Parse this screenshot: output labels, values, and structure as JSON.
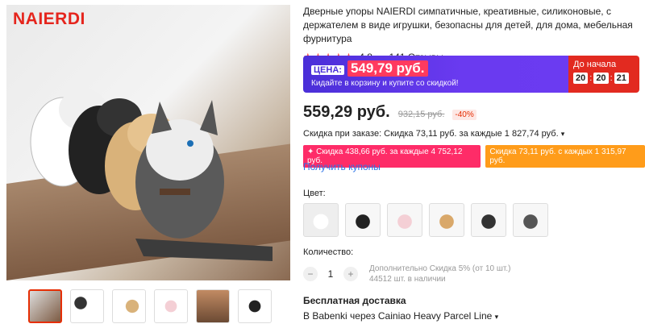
{
  "brand": "NAIERDI",
  "product": {
    "title": "Дверные упоры NAIERDI симпатичные, креативные, силиконовые, с держателем в виде игрушки, безопасны для детей, для дома, мебельная фурнитура",
    "rating": "4.8",
    "rating_fraction": 0.96,
    "stars": "★★★★★",
    "reviews": "141 Отзывы"
  },
  "promo": {
    "price_label": "ЦЕНА:",
    "price": "549,79 руб.",
    "subtitle": "Кидайте в корзину и купите со скидкой!",
    "countdown_label": "До начала",
    "hh": "20",
    "mm": "20",
    "ss": "21"
  },
  "pricing": {
    "price": "559,29 руб.",
    "old_price": "932,15 руб.",
    "discount": "-40%"
  },
  "order_discount": "Скидка при заказе: Скидка 73,11 руб. за каждые 1 827,74 руб.",
  "tags": {
    "pink": "✦ Скидка 438,66 руб. за каждые 4 752,12 руб.",
    "orange": "Скидка 73,11 руб. с каждых 1 315,97 руб."
  },
  "coupons_link": "Получить купоны",
  "color_label": "Цвет:",
  "quantity": {
    "label": "Количество:",
    "minus": "−",
    "value": "1",
    "plus": "+",
    "note1": "Дополнительно Скидка 5% (от 10 шт.)",
    "note2": "44512 шт. в наличии"
  },
  "shipping": {
    "title": "Бесплатная доставка",
    "line": "В Babenki через Cainiao Heavy Parcel Line"
  },
  "colors": {
    "brand_red": "#e5251d",
    "promo_purple": "#4a2fd8",
    "promo_red": "#e22a20",
    "link_blue": "#2a73e8"
  },
  "icons": [
    "star-icon",
    "chevron-down-icon",
    "minus-icon",
    "plus-icon"
  ]
}
